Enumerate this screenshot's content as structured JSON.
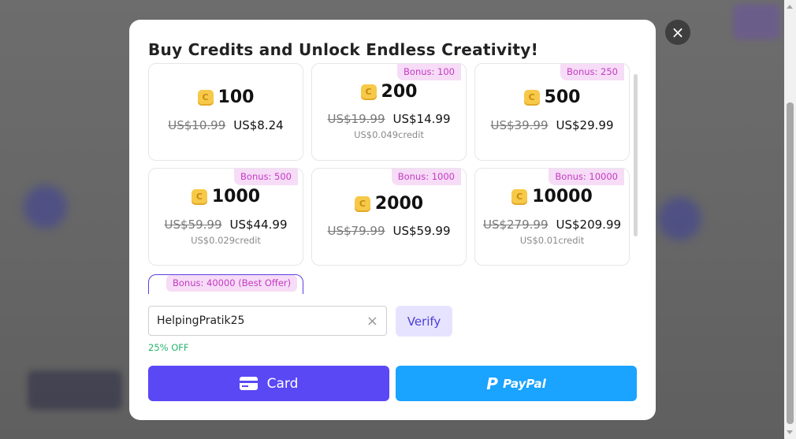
{
  "modal": {
    "title": "Buy Credits and Unlock Endless Creativity!",
    "close_icon": "×"
  },
  "packages": [
    {
      "amount": "100",
      "bonus": "",
      "old_price": "US$10.99",
      "new_price": "US$8.24",
      "per_credit": ""
    },
    {
      "amount": "200",
      "bonus": "Bonus: 100",
      "old_price": "US$19.99",
      "new_price": "US$14.99",
      "per_credit": "US$0.049credit"
    },
    {
      "amount": "500",
      "bonus": "Bonus: 250",
      "old_price": "US$39.99",
      "new_price": "US$29.99",
      "per_credit": ""
    },
    {
      "amount": "1000",
      "bonus": "Bonus: 500",
      "old_price": "US$59.99",
      "new_price": "US$44.99",
      "per_credit": "US$0.029credit"
    },
    {
      "amount": "2000",
      "bonus": "Bonus: 1000",
      "old_price": "US$79.99",
      "new_price": "US$59.99",
      "per_credit": ""
    },
    {
      "amount": "10000",
      "bonus": "Bonus: 10000",
      "old_price": "US$279.99",
      "new_price": "US$209.99",
      "per_credit": "US$0.01credit"
    },
    {
      "amount": "",
      "bonus": "Bonus: 40000 (Best Offer)",
      "old_price": "",
      "new_price": "",
      "per_credit": ""
    }
  ],
  "coupon": {
    "value": "HelpingPratik25",
    "clear_icon": "×",
    "verify_label": "Verify",
    "discount_text": "25% OFF"
  },
  "payment": {
    "card_label": "Card",
    "paypal_icon": "P",
    "paypal_label": "PayPal"
  },
  "colors": {
    "accent": "#5a48f5",
    "paypal": "#1aa3ff",
    "bonus_bg": "#f6dcf6",
    "bonus_text": "#c43ac4",
    "discount": "#26b36f"
  }
}
